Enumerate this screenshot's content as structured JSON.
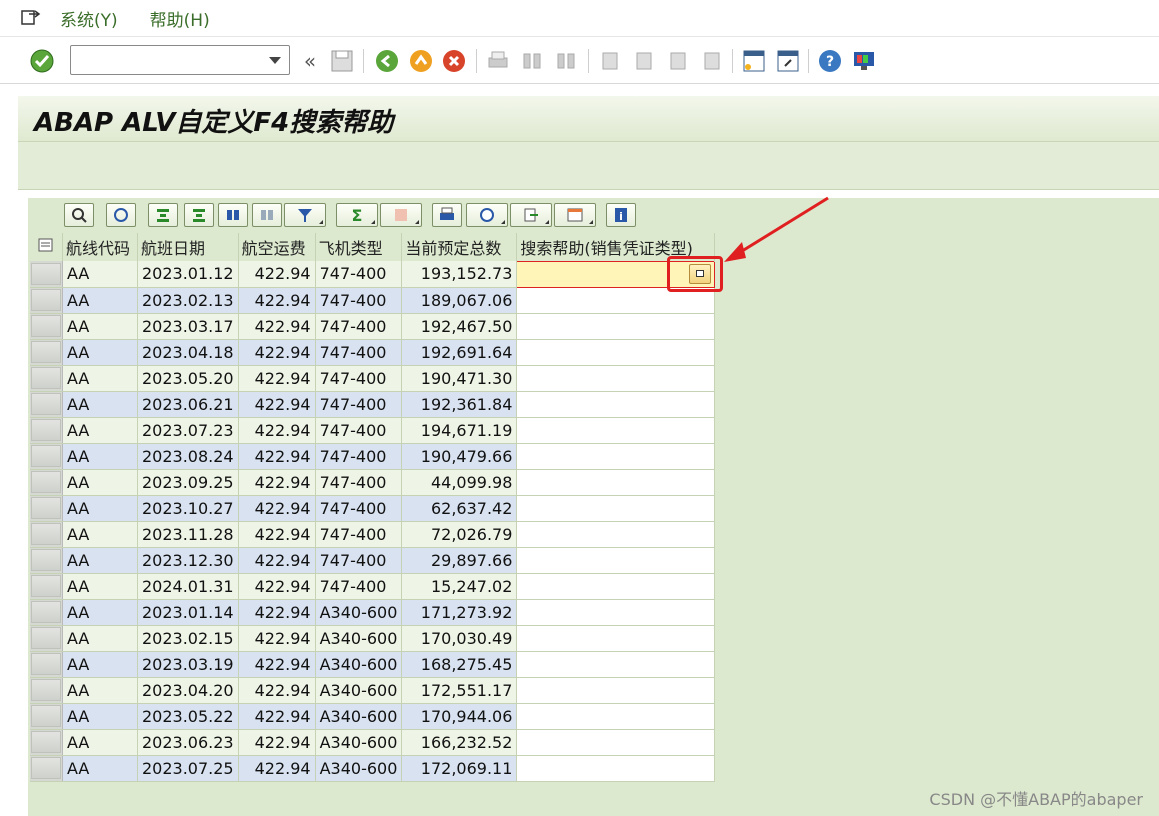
{
  "menu": {
    "items": [
      "系统(Y)",
      "帮助(H)"
    ]
  },
  "toolbar": {
    "command_value": "",
    "back_label": "«"
  },
  "title": "ABAP ALV自定义F4搜索帮助",
  "grid": {
    "columns": [
      "航线代码",
      "航班日期",
      "航空运费",
      "飞机类型",
      "当前预定总数",
      "搜索帮助(销售凭证类型)"
    ],
    "rows": [
      [
        "AA",
        "2023.01.12",
        "422.94",
        "747-400",
        "193,152.73",
        ""
      ],
      [
        "AA",
        "2023.02.13",
        "422.94",
        "747-400",
        "189,067.06",
        ""
      ],
      [
        "AA",
        "2023.03.17",
        "422.94",
        "747-400",
        "192,467.50",
        ""
      ],
      [
        "AA",
        "2023.04.18",
        "422.94",
        "747-400",
        "192,691.64",
        ""
      ],
      [
        "AA",
        "2023.05.20",
        "422.94",
        "747-400",
        "190,471.30",
        ""
      ],
      [
        "AA",
        "2023.06.21",
        "422.94",
        "747-400",
        "192,361.84",
        ""
      ],
      [
        "AA",
        "2023.07.23",
        "422.94",
        "747-400",
        "194,671.19",
        ""
      ],
      [
        "AA",
        "2023.08.24",
        "422.94",
        "747-400",
        "190,479.66",
        ""
      ],
      [
        "AA",
        "2023.09.25",
        "422.94",
        "747-400",
        "44,099.98",
        ""
      ],
      [
        "AA",
        "2023.10.27",
        "422.94",
        "747-400",
        "62,637.42",
        ""
      ],
      [
        "AA",
        "2023.11.28",
        "422.94",
        "747-400",
        "72,026.79",
        ""
      ],
      [
        "AA",
        "2023.12.30",
        "422.94",
        "747-400",
        "29,897.66",
        ""
      ],
      [
        "AA",
        "2024.01.31",
        "422.94",
        "747-400",
        "15,247.02",
        ""
      ],
      [
        "AA",
        "2023.01.14",
        "422.94",
        "A340-600",
        "171,273.92",
        ""
      ],
      [
        "AA",
        "2023.02.15",
        "422.94",
        "A340-600",
        "170,030.49",
        ""
      ],
      [
        "AA",
        "2023.03.19",
        "422.94",
        "A340-600",
        "168,275.45",
        ""
      ],
      [
        "AA",
        "2023.04.20",
        "422.94",
        "A340-600",
        "172,551.17",
        ""
      ],
      [
        "AA",
        "2023.05.22",
        "422.94",
        "A340-600",
        "170,944.06",
        ""
      ],
      [
        "AA",
        "2023.06.23",
        "422.94",
        "A340-600",
        "166,232.52",
        ""
      ],
      [
        "AA",
        "2023.07.25",
        "422.94",
        "A340-600",
        "172,069.11",
        ""
      ]
    ]
  },
  "watermark": "CSDN @不懂ABAP的abaper",
  "colors": {
    "accent": "#e02020",
    "green": "#3b6e2a"
  }
}
